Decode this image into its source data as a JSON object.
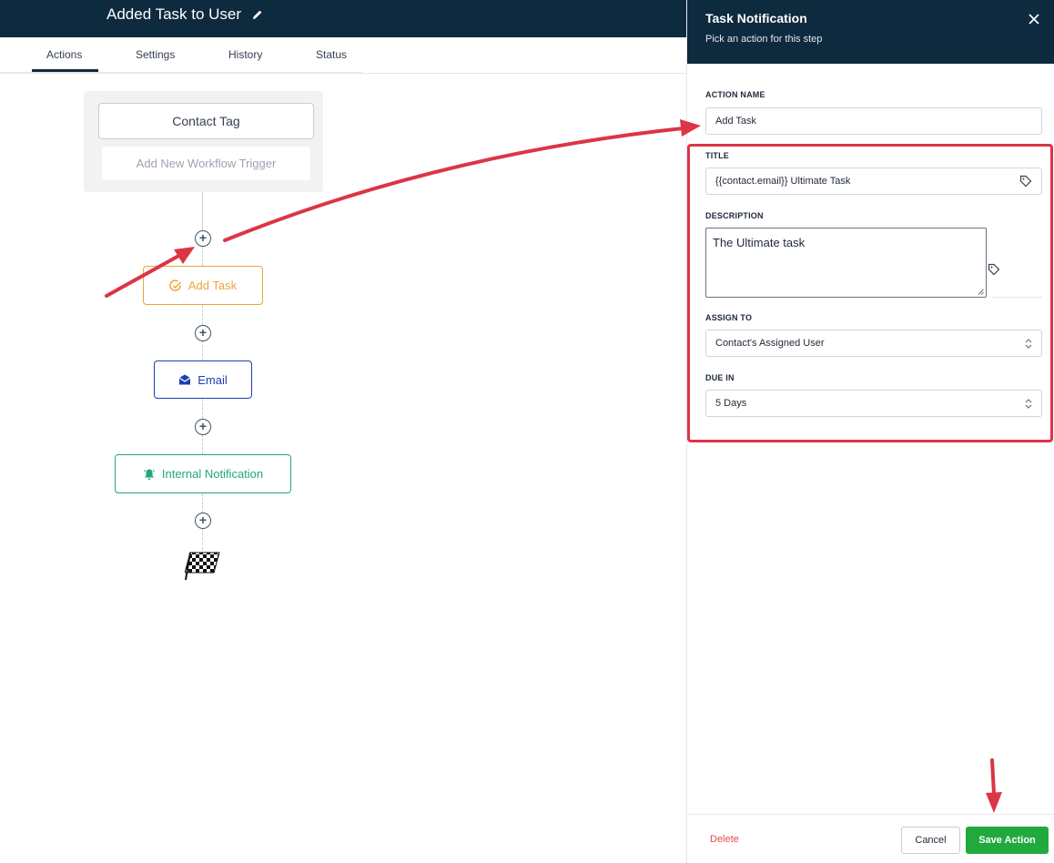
{
  "workflow": {
    "title": "Added Task to User"
  },
  "tabs": [
    {
      "label": "Actions",
      "active": true
    },
    {
      "label": "Settings"
    },
    {
      "label": "History"
    },
    {
      "label": "Status"
    }
  ],
  "canvas": {
    "trigger": "Contact Tag",
    "add_trigger": "Add New Workflow Trigger",
    "nodes": [
      {
        "label": "Add Task",
        "icon": "task-check-icon",
        "color": "#f0a23a"
      },
      {
        "label": "Email",
        "icon": "email-icon",
        "color": "#1e40af"
      },
      {
        "label": "Internal Notification",
        "icon": "bell-icon",
        "color": "#22a77a"
      }
    ]
  },
  "panel": {
    "title": "Task Notification",
    "subtitle": "Pick an action for this step",
    "action_name": {
      "label": "ACTION NAME",
      "value": "Add Task"
    },
    "title_field": {
      "label": "TITLE",
      "value": "{{contact.email}} Ultimate Task"
    },
    "description": {
      "label": "DESCRIPTION",
      "value": "The Ultimate task"
    },
    "assign_to": {
      "label": "ASSIGN TO",
      "value": "Contact's Assigned User"
    },
    "due_in": {
      "label": "DUE IN",
      "value": "5 Days"
    },
    "footer": {
      "delete": "Delete",
      "cancel": "Cancel",
      "save": "Save Action"
    }
  },
  "colors": {
    "header": "#0e2a3e",
    "annotation": "#dc3545",
    "save": "#22a93e"
  }
}
